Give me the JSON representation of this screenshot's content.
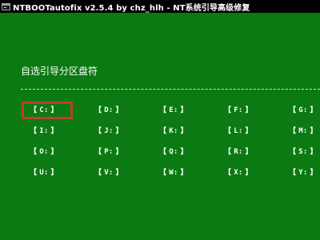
{
  "window": {
    "title": "NTBOOTautofix v2.5.4 by chz_hlh - NT系统引导高级修复",
    "icon": "console-window-icon"
  },
  "console": {
    "heading": "自选引导分区盘符",
    "selected_drive": "C:",
    "highlight_color": "#b5412a",
    "background_color": "#0b7a12",
    "drive_grid": [
      [
        "C:",
        "D:",
        "E:",
        "F:",
        "G:"
      ],
      [
        "I:",
        "J:",
        "K:",
        "L:",
        "M:"
      ],
      [
        "O:",
        "P:",
        "Q:",
        "R:",
        "S:"
      ],
      [
        "U:",
        "V:",
        "W:",
        "X:",
        "Y:"
      ]
    ]
  }
}
